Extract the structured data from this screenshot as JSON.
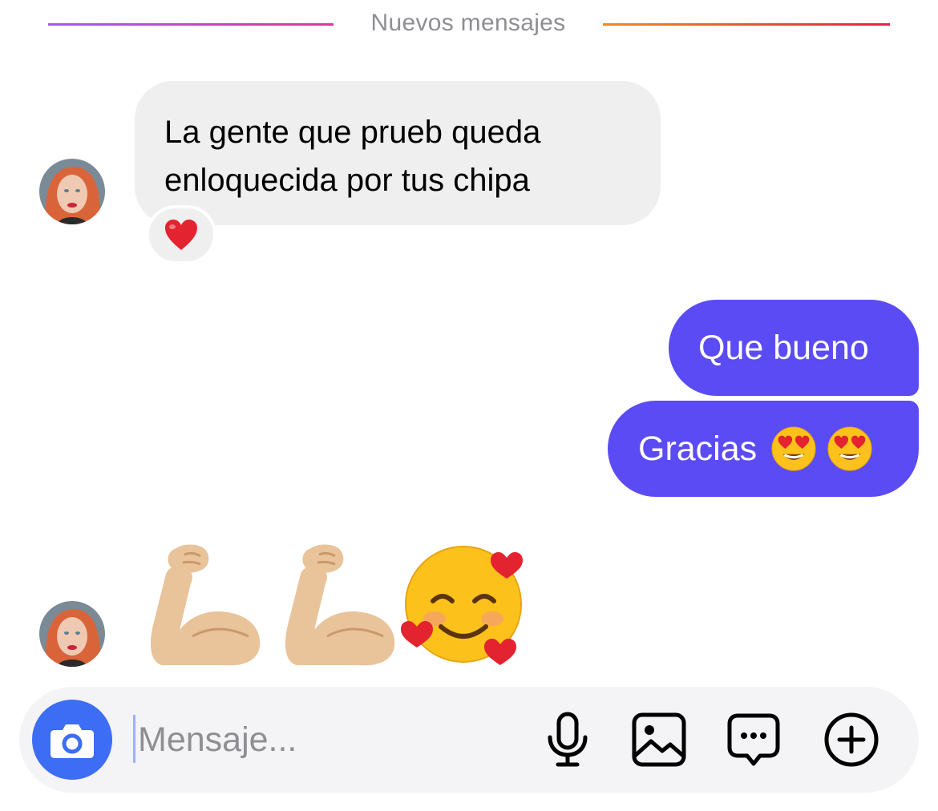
{
  "divider": {
    "label": "Nuevos mensajes"
  },
  "incoming_message": {
    "lines": [
      "La gente que prueb queda",
      "enloquecida por tus chipa"
    ],
    "reaction": "❤️"
  },
  "outgoing_messages": [
    {
      "text": "Que bueno"
    },
    {
      "text": "Gracias",
      "emojis": [
        "😍",
        "😍"
      ]
    }
  ],
  "emoji_message": {
    "emojis": [
      "💪🏼",
      "💪🏼",
      "🥰"
    ]
  },
  "composer": {
    "placeholder": "Mensaje...",
    "icons": [
      "camera-icon",
      "microphone-icon",
      "gallery-icon",
      "sticker-icon",
      "plus-icon"
    ]
  },
  "colors": {
    "outgoing_bubble": "#5b4bf5",
    "incoming_bubble": "#efefef",
    "camera_button": "#3d6df5",
    "divider_left_gradient": [
      "#a05cf0",
      "#e0359a"
    ],
    "divider_right_gradient": [
      "#f08a1c",
      "#e3214a"
    ]
  }
}
